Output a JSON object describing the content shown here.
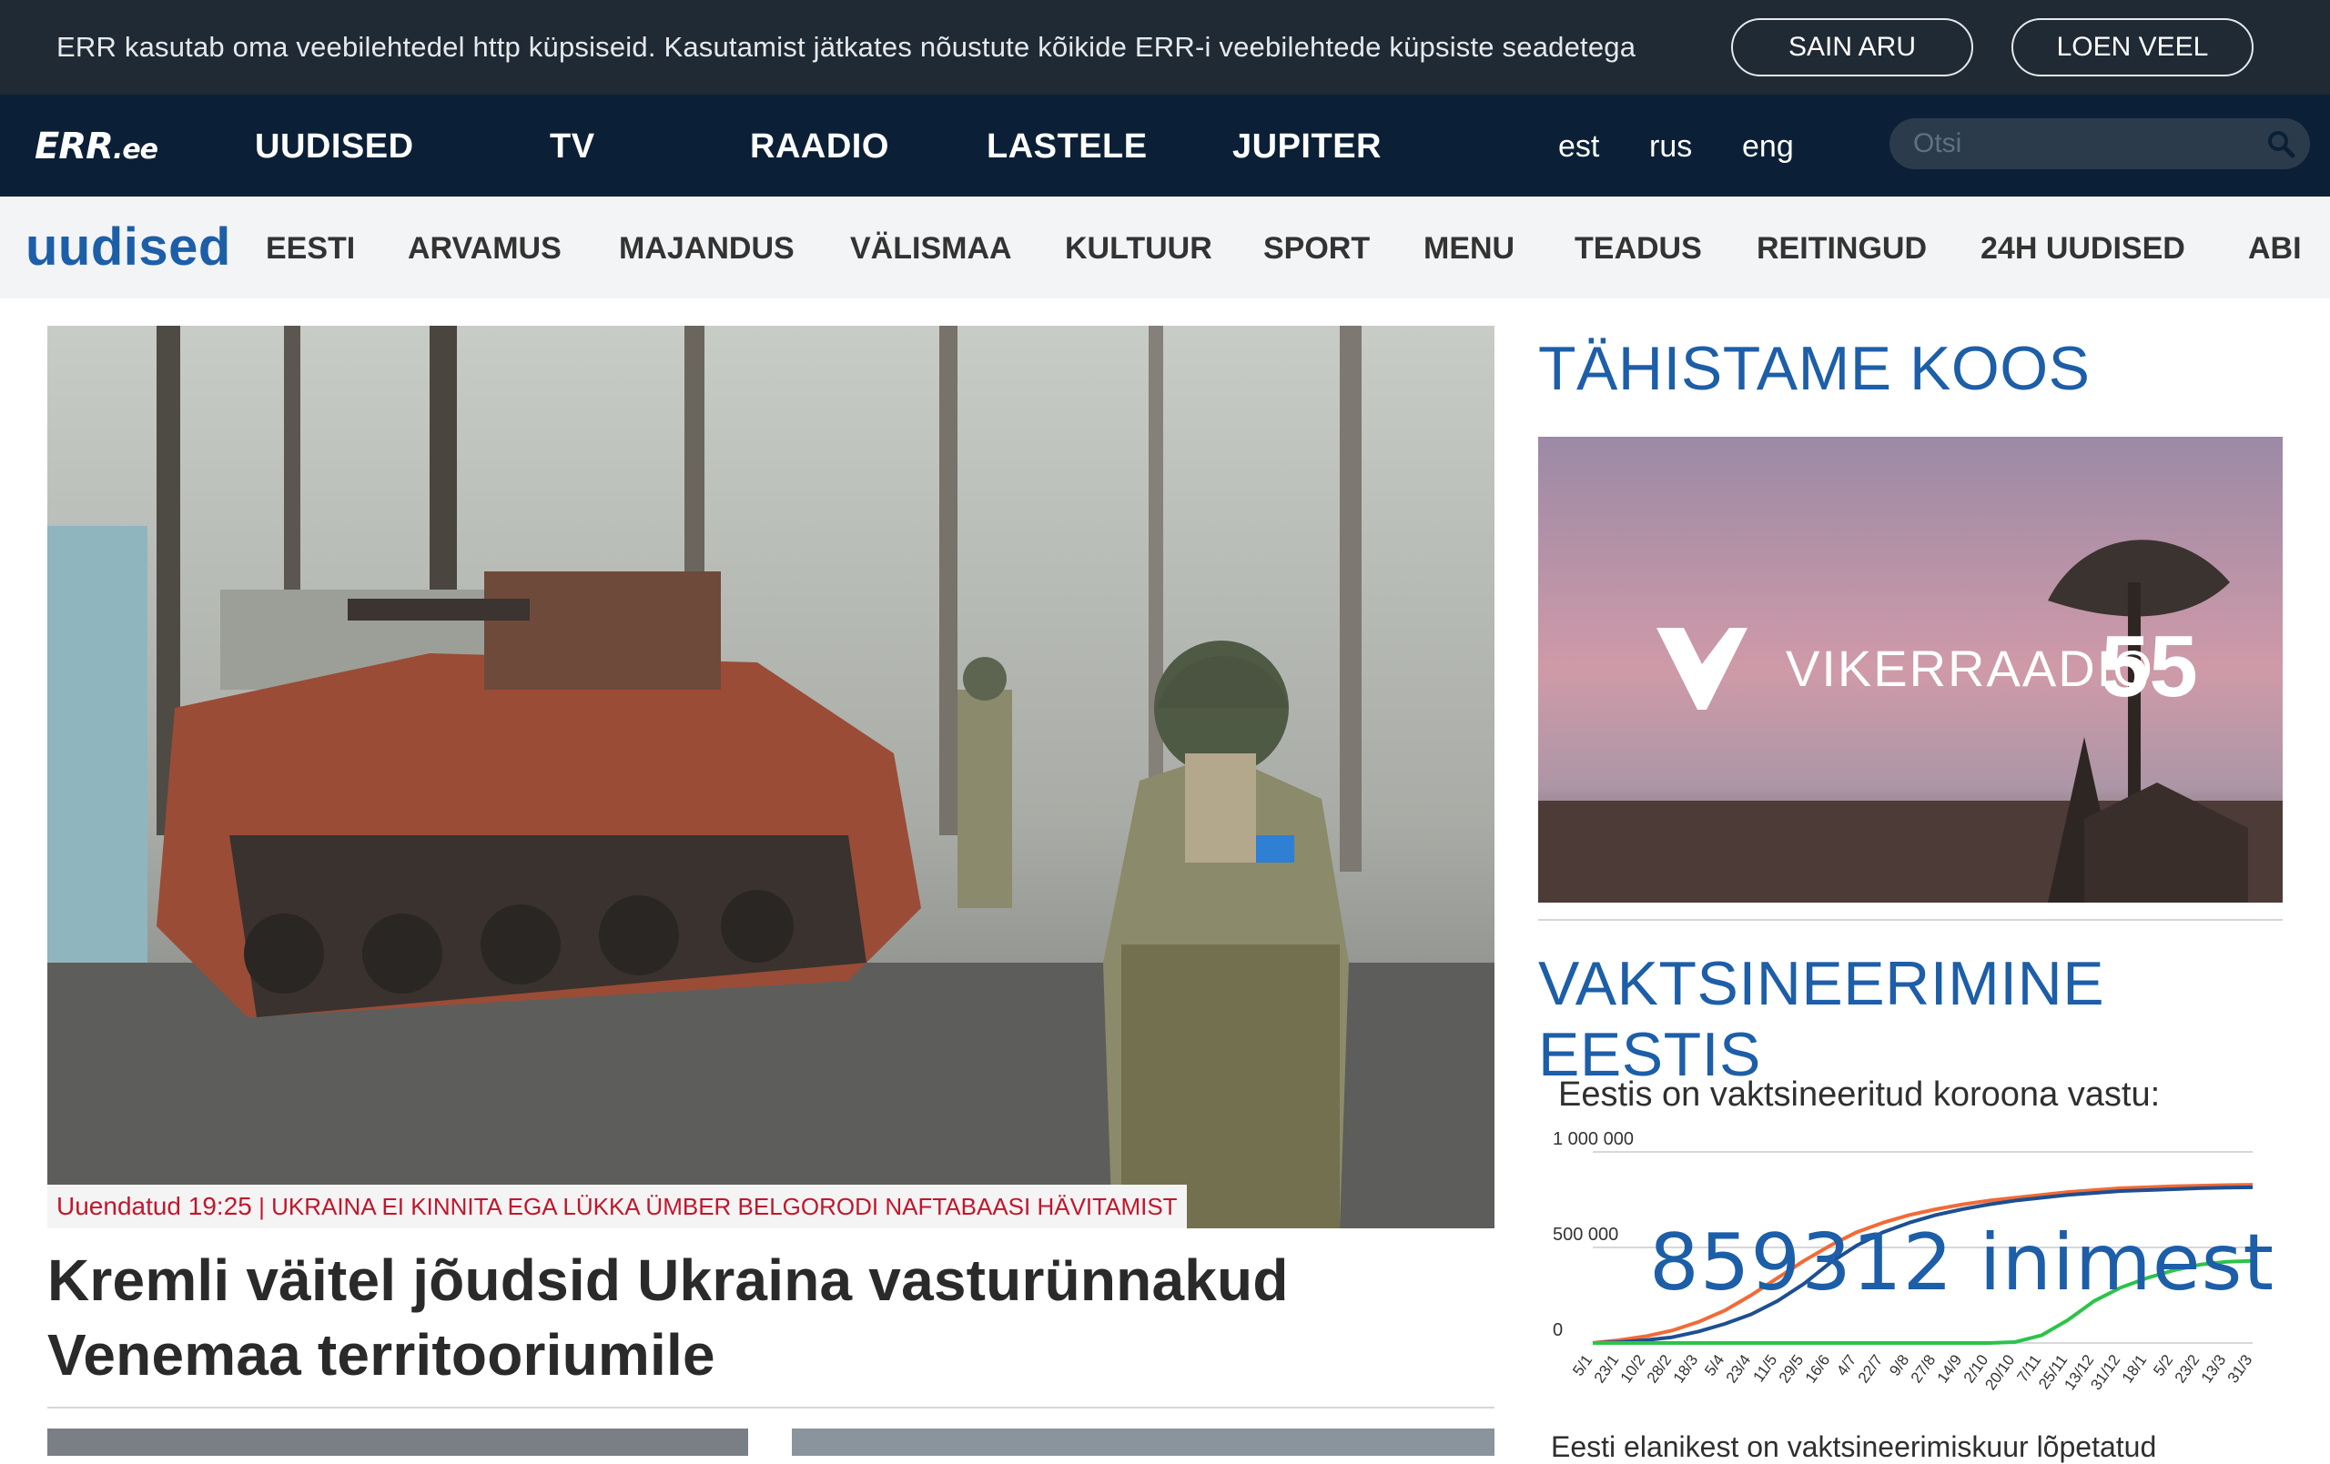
{
  "cookie": {
    "text": "ERR kasutab oma veebilehtedel http küpsiseid. Kasutamist jätkates nõustute kõikide ERR-i veebilehtede küpsiste seadetega",
    "accept_label": "SAIN ARU",
    "more_label": "LOEN VEEL"
  },
  "brand": {
    "logo": "ERR",
    "logo_suffix": ".ee",
    "section": "uudised"
  },
  "topnav": {
    "items": [
      "UUDISED",
      "TV",
      "RAADIO",
      "LASTELE",
      "JUPITER"
    ],
    "languages": [
      "est",
      "rus",
      "eng"
    ],
    "search_placeholder": "Otsi"
  },
  "subnav": {
    "items": [
      "EESTI",
      "ARVAMUS",
      "MAJANDUS",
      "VÄLISMAA",
      "KULTUUR",
      "SPORT",
      "MENU",
      "TEADUS",
      "REITINGUD",
      "24H UUDISED",
      "ABI"
    ]
  },
  "main": {
    "tag_updated": "Uuendatud 19:25",
    "tag_separator": "|",
    "tag_topic": "UKRAINA EI KINNITA EGA LÜKKA ÜMBER BELGORODI NAFTABAASI HÄVITAMIST",
    "headline": "Kremli väitel jõudsid Ukraina vasturünnakud Venemaa territooriumile"
  },
  "sidebar": {
    "promo_title": "TÄHISTAME KOOS",
    "promo_brand": "VIKERRAADIO",
    "promo_number": "55",
    "vax_title": "VAKTSINEERIMINE EESTIS",
    "vax_subtitle": "Eestis on vaktsineeritud koroona vastu:",
    "vax_count": "859312 inimest",
    "vax_footer": "Eesti elanikest on vaktsineerimiskuur lõpetatud"
  },
  "chart_data": {
    "type": "line",
    "y_tick_labels": [
      "1 000 000",
      "500 000",
      "0"
    ],
    "ylim": [
      0,
      1000000
    ],
    "x_tick_labels": [
      "5/1",
      "23/1",
      "10/2",
      "28/2",
      "18/3",
      "5/4",
      "23/4",
      "11/5",
      "29/5",
      "16/6",
      "4/7",
      "22/7",
      "9/8",
      "27/8",
      "14/9",
      "2/10",
      "20/10",
      "7/11",
      "25/11",
      "13/12",
      "31/12",
      "18/1",
      "5/2",
      "23/2",
      "13/3",
      "31/3"
    ],
    "series": [
      {
        "color": "#f26a36",
        "values": [
          0,
          15000,
          35000,
          65000,
          110000,
          170000,
          250000,
          340000,
          430000,
          510000,
          580000,
          630000,
          670000,
          700000,
          725000,
          745000,
          760000,
          775000,
          790000,
          800000,
          810000,
          815000,
          820000,
          823000,
          826000,
          828000
        ]
      },
      {
        "color": "#1d4f91",
        "values": [
          0,
          5000,
          15000,
          30000,
          60000,
          100000,
          150000,
          220000,
          310000,
          420000,
          510000,
          580000,
          630000,
          670000,
          700000,
          725000,
          745000,
          760000,
          775000,
          785000,
          795000,
          800000,
          805000,
          810000,
          813000,
          815000
        ]
      },
      {
        "color": "#2cc34a",
        "values": [
          0,
          0,
          0,
          0,
          0,
          0,
          0,
          0,
          0,
          0,
          0,
          0,
          0,
          0,
          0,
          0,
          5000,
          40000,
          120000,
          220000,
          290000,
          340000,
          380000,
          410000,
          425000,
          430000
        ]
      }
    ]
  }
}
